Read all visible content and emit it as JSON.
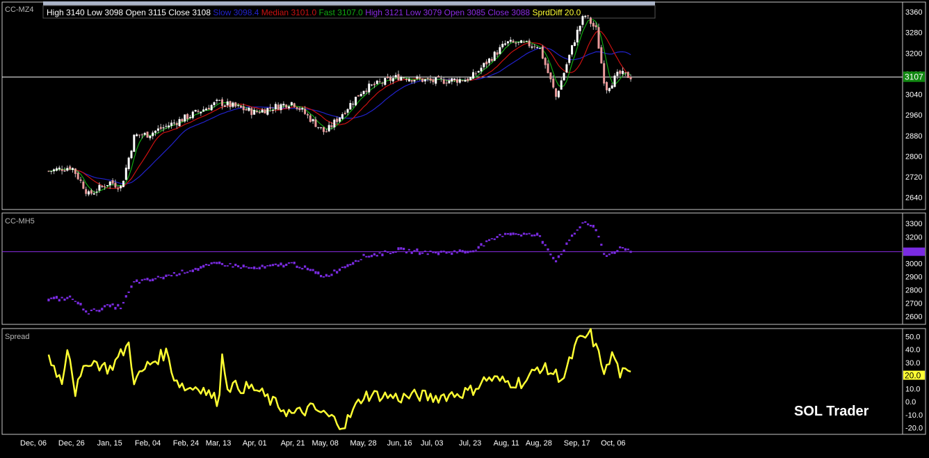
{
  "colors": {
    "background": "#000000",
    "frame": "#c8c8c8",
    "grid": "#ffffff",
    "text": "#ffffff",
    "label_gray": "#b4b4b4",
    "candle_up": "#ffffff",
    "candle_down": "#e89a9a",
    "slow": "#2222cc",
    "median": "#cc1111",
    "fast": "#11aa11",
    "purple": "#7a2be2",
    "purple_label": "#8a2be2",
    "spread": "#ffff33",
    "last_price_box": "#118811",
    "header_bar": "#aab4c8"
  },
  "header": {
    "items": [
      {
        "label": "High",
        "value": "3140",
        "color": "#ffffff"
      },
      {
        "label": "Low",
        "value": "3098",
        "color": "#ffffff"
      },
      {
        "label": "Open",
        "value": "3115",
        "color": "#ffffff"
      },
      {
        "label": "Close",
        "value": "3108",
        "color": "#ffffff"
      },
      {
        "label": "Slow",
        "value": "3098.4",
        "color": "#2222cc"
      },
      {
        "label": "Median",
        "value": "3101.0",
        "color": "#cc1111"
      },
      {
        "label": "Fast",
        "value": "3107.0",
        "color": "#11aa11"
      },
      {
        "label": "High",
        "value": "3121",
        "color": "#8a2be2"
      },
      {
        "label": "Low",
        "value": "3079",
        "color": "#8a2be2"
      },
      {
        "label": "Open",
        "value": "3085",
        "color": "#8a2be2"
      },
      {
        "label": "Close",
        "value": "3088",
        "color": "#8a2be2"
      },
      {
        "label": "SprdDiff",
        "value": "20.0",
        "color": "#ffff33"
      }
    ]
  },
  "watermark": "SOL Trader",
  "chart_data": [
    {
      "type": "candlestick",
      "title": "CC-MZ4",
      "y_ticks": [
        3360,
        3280,
        3200,
        3120,
        3040,
        2960,
        2880,
        2800,
        2720,
        2640
      ],
      "ylim": [
        2593,
        3398
      ],
      "last_value_label": "3107",
      "last_value": 3107,
      "key_points": [
        {
          "date": "Dec 06",
          "close": 2730
        },
        {
          "date": "Dec 26",
          "close": 2760
        },
        {
          "date": "Jan 04",
          "close": 2650
        },
        {
          "date": "Jan 15",
          "close": 2700
        },
        {
          "date": "Jan 21",
          "close": 2680
        },
        {
          "date": "Jan 28",
          "close": 2880
        },
        {
          "date": "Feb 04",
          "close": 2885
        },
        {
          "date": "Feb 24",
          "close": 2950
        },
        {
          "date": "Mar 13",
          "close": 3010
        },
        {
          "date": "Apr 01",
          "close": 2970
        },
        {
          "date": "Apr 21",
          "close": 3010
        },
        {
          "date": "May 08",
          "close": 2890
        },
        {
          "date": "May 28",
          "close": 3060
        },
        {
          "date": "Jun 16",
          "close": 3110
        },
        {
          "date": "Jul 03",
          "close": 3090
        },
        {
          "date": "Jul 23",
          "close": 3100
        },
        {
          "date": "Aug 11",
          "close": 3240
        },
        {
          "date": "Aug 28",
          "close": 3230
        },
        {
          "date": "Sep 06",
          "close": 3030
        },
        {
          "date": "Sep 17",
          "close": 3280
        },
        {
          "date": "Sep 21",
          "close": 3350
        },
        {
          "date": "Sep 27",
          "close": 3290
        },
        {
          "date": "Oct 02",
          "close": 3060
        },
        {
          "date": "Oct 09",
          "close": 3120
        },
        {
          "date": "Oct 16",
          "close": 3107
        }
      ],
      "series": [
        {
          "name": "Slow",
          "color": "#2222cc",
          "value": 3098.4
        },
        {
          "name": "Median",
          "color": "#cc1111",
          "value": 3101.0
        },
        {
          "name": "Fast",
          "color": "#11aa11",
          "value": 3107.0
        }
      ]
    },
    {
      "type": "bar",
      "title": "CC-MH5",
      "y_ticks": [
        3300,
        3200,
        3100,
        3000,
        2900,
        2800,
        2700,
        2600
      ],
      "ylim": [
        2540,
        3380
      ],
      "last_value": 3088,
      "key_points": [
        {
          "date": "Dec 06",
          "close": 2720
        },
        {
          "date": "Dec 26",
          "close": 2740
        },
        {
          "date": "Jan 04",
          "close": 2630
        },
        {
          "date": "Jan 15",
          "close": 2680
        },
        {
          "date": "Jan 21",
          "close": 2670
        },
        {
          "date": "Jan 28",
          "close": 2860
        },
        {
          "date": "Feb 04",
          "close": 2870
        },
        {
          "date": "Feb 24",
          "close": 2940
        },
        {
          "date": "Mar 13",
          "close": 3000
        },
        {
          "date": "Apr 01",
          "close": 2960
        },
        {
          "date": "Apr 21",
          "close": 3000
        },
        {
          "date": "May 08",
          "close": 2900
        },
        {
          "date": "May 28",
          "close": 3050
        },
        {
          "date": "Jun 16",
          "close": 3100
        },
        {
          "date": "Jul 03",
          "close": 3080
        },
        {
          "date": "Jul 23",
          "close": 3090
        },
        {
          "date": "Aug 11",
          "close": 3230
        },
        {
          "date": "Aug 28",
          "close": 3210
        },
        {
          "date": "Sep 06",
          "close": 3020
        },
        {
          "date": "Sep 17",
          "close": 3250
        },
        {
          "date": "Sep 21",
          "close": 3320
        },
        {
          "date": "Sep 27",
          "close": 3250
        },
        {
          "date": "Oct 02",
          "close": 3050
        },
        {
          "date": "Oct 09",
          "close": 3110
        },
        {
          "date": "Oct 16",
          "close": 3088
        }
      ]
    },
    {
      "type": "line",
      "title": "Spread",
      "y_ticks": [
        "50.0",
        "40.0",
        "30.0",
        "20.0",
        "10.0",
        "0.0",
        "-10.0",
        "-20.0"
      ],
      "ylim": [
        -25,
        56
      ],
      "last_value_label": "20.0",
      "last_value": 20.0,
      "points": [
        {
          "date": "Dec 06",
          "value": 23
        },
        {
          "date": "Dec 14",
          "value": 35
        },
        {
          "date": "Dec 21",
          "value": 15
        },
        {
          "date": "Dec 24",
          "value": 45
        },
        {
          "date": "Dec 28",
          "value": 8
        },
        {
          "date": "Jan 04",
          "value": 32
        },
        {
          "date": "Jan 15",
          "value": 25
        },
        {
          "date": "Jan 25",
          "value": 44
        },
        {
          "date": "Jan 28",
          "value": 15
        },
        {
          "date": "Feb 04",
          "value": 28
        },
        {
          "date": "Feb 14",
          "value": 38
        },
        {
          "date": "Feb 18",
          "value": 18
        },
        {
          "date": "Feb 24",
          "value": 10
        },
        {
          "date": "Mar 03",
          "value": 12
        },
        {
          "date": "Mar 13",
          "value": 0
        },
        {
          "date": "Mar 15",
          "value": 34
        },
        {
          "date": "Mar 18",
          "value": 12
        },
        {
          "date": "Apr 01",
          "value": 10
        },
        {
          "date": "Apr 10",
          "value": 0
        },
        {
          "date": "Apr 21",
          "value": -10
        },
        {
          "date": "May 01",
          "value": -5
        },
        {
          "date": "May 08",
          "value": -10
        },
        {
          "date": "May 18",
          "value": -18
        },
        {
          "date": "May 28",
          "value": 5
        },
        {
          "date": "Jun 06",
          "value": 5
        },
        {
          "date": "Jun 16",
          "value": 3
        },
        {
          "date": "Jun 26",
          "value": 5
        },
        {
          "date": "Jul 03",
          "value": 3
        },
        {
          "date": "Jul 23",
          "value": 8
        },
        {
          "date": "Aug 01",
          "value": 18
        },
        {
          "date": "Aug 11",
          "value": 15
        },
        {
          "date": "Aug 21",
          "value": 15
        },
        {
          "date": "Aug 28",
          "value": 27
        },
        {
          "date": "Sep 10",
          "value": 18
        },
        {
          "date": "Sep 17",
          "value": 45
        },
        {
          "date": "Sep 24",
          "value": 52
        },
        {
          "date": "Oct 02",
          "value": 22
        },
        {
          "date": "Oct 06",
          "value": 38
        },
        {
          "date": "Oct 09",
          "value": 22
        },
        {
          "date": "Oct 16",
          "value": 20
        }
      ]
    }
  ],
  "x_axis": {
    "labels": [
      "Dec, 06",
      "Dec, 26",
      "Jan, 15",
      "Feb, 04",
      "Feb, 24",
      "Mar, 13",
      "Apr, 01",
      "Apr, 21",
      "May, 08",
      "May, 28",
      "Jun, 16",
      "Jul, 03",
      "Jul, 23",
      "Aug, 11",
      "Aug, 28",
      "Sep, 17",
      "Oct, 06"
    ]
  }
}
